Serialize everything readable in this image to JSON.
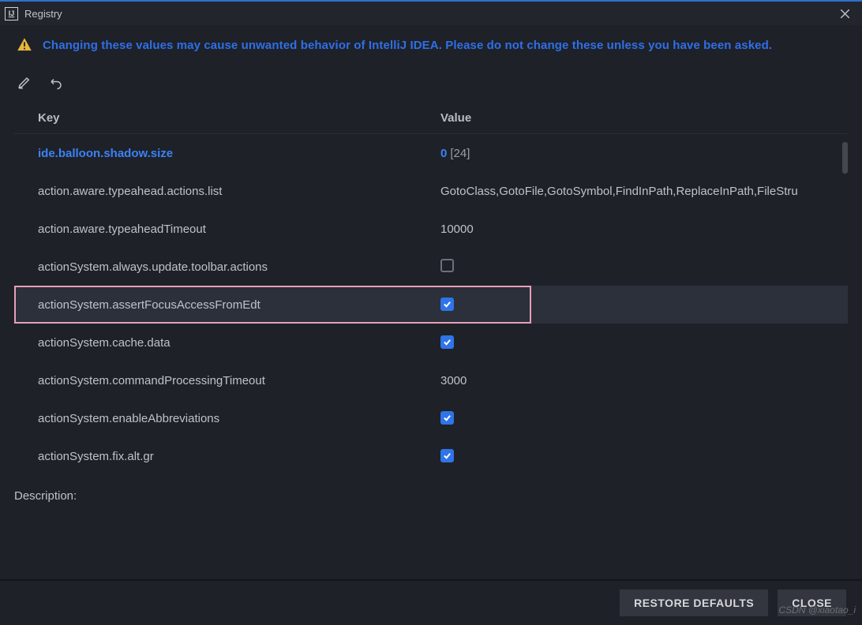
{
  "window": {
    "title": "Registry"
  },
  "warning": "Changing these values may cause unwanted behavior of IntelliJ IDEA. Please do not change these unless you have been asked.",
  "columns": {
    "key": "Key",
    "value": "Value"
  },
  "rows": [
    {
      "key": "ide.balloon.shadow.size",
      "value": "0",
      "valueDefault": "[24]",
      "type": "text",
      "modified": true
    },
    {
      "key": "action.aware.typeahead.actions.list",
      "value": "GotoClass,GotoFile,GotoSymbol,FindInPath,ReplaceInPath,FileStru",
      "type": "text"
    },
    {
      "key": "action.aware.typeaheadTimeout",
      "value": "10000",
      "type": "text"
    },
    {
      "key": "actionSystem.always.update.toolbar.actions",
      "value": false,
      "type": "bool"
    },
    {
      "key": "actionSystem.assertFocusAccessFromEdt",
      "value": true,
      "type": "bool",
      "selected": true,
      "highlighted": true
    },
    {
      "key": "actionSystem.cache.data",
      "value": true,
      "type": "bool"
    },
    {
      "key": "actionSystem.commandProcessingTimeout",
      "value": "3000",
      "type": "text"
    },
    {
      "key": "actionSystem.enableAbbreviations",
      "value": true,
      "type": "bool"
    },
    {
      "key": "actionSystem.fix.alt.gr",
      "value": true,
      "type": "bool"
    }
  ],
  "descriptionLabel": "Description:",
  "buttons": {
    "restore": "RESTORE DEFAULTS",
    "close": "CLOSE"
  },
  "watermark": "CSDN @xiaotao_i"
}
